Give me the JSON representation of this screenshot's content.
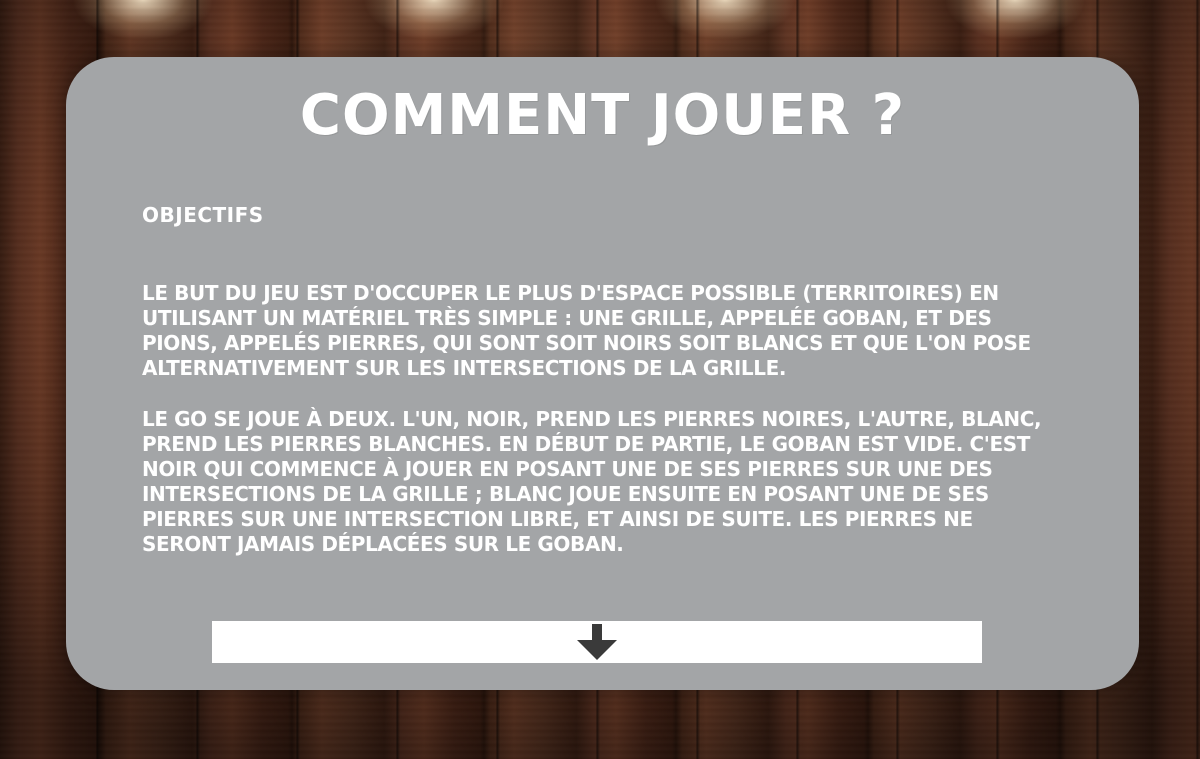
{
  "title": "Comment jouer ?",
  "sections": [
    {
      "heading": "Objectifs",
      "paragraphs": [
        "Le but du jeu est d'occuper le plus d'espace possible (territoires) en utilisant un matériel très simple : une grille, appelée goban, et des pions, appelés pierres, qui sont soit noirs soit blancs et que l'on pose alternativement sur les intersections de la grille.",
        "Le go se joue à deux. L'un, noir, prend les pierres noires, l'autre, blanc, prend les pierres blanches. En début de partie, le goban est vide. C'est noir qui commence à jouer en posant une de ses pierres sur une des intersections de la grille ; blanc joue ensuite en posant une de ses pierres sur une intersection libre, et ainsi de suite. Les pierres ne seront jamais déplacées sur le goban."
      ]
    }
  ],
  "scroll_button": {
    "icon": "arrow-down-icon"
  },
  "colors": {
    "panel": "#a3a5a7",
    "text": "#ffffff",
    "button": "#ffffff",
    "arrow": "#3a3a3a"
  }
}
